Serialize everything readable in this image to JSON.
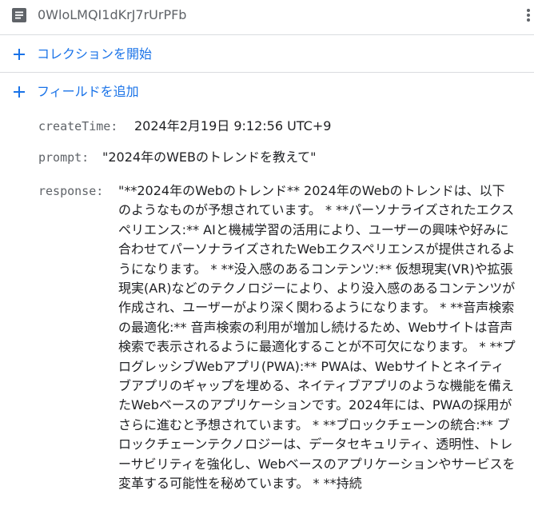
{
  "document": {
    "id": "0WloLMQI1dKrJ7rUrPFb",
    "icon": "document-icon",
    "menu_icon": "more-vert-icon"
  },
  "actions": {
    "start_collection": "コレクションを開始",
    "add_field": "フィールドを追加",
    "icon": "plus-icon",
    "accent_color": "#1a73e8"
  },
  "fields": {
    "createTime": {
      "key": "createTime:",
      "value": "2024年2月19日 9:12:56 UTC+9"
    },
    "prompt": {
      "key": "prompt:",
      "value": "\"2024年のWEBのトレンドを教えて\""
    },
    "response": {
      "key": "response:",
      "value": "\"**2024年のWebのトレンド** 2024年のWebのトレンドは、以下のようなものが予想されています。 * **パーソナライズされたエクスペリエンス:** AIと機械学習の活用により、ユーザーの興味や好みに合わせてパーソナライズされたWebエクスペリエンスが提供されるようになります。 * **没入感のあるコンテンツ:** 仮想現実(VR)や拡張現実(AR)などのテクノロジーにより、より没入感のあるコンテンツが作成され、ユーザーがより深く関わるようになります。 * **音声検索の最適化:** 音声検索の利用が増加し続けるため、Webサイトは音声検索で表示されるように最適化することが不可欠になります。 * **プログレッシブWebアプリ(PWA):** PWAは、Webサイトとネイティブアプリのギャップを埋める、ネイティブアプリのような機能を備えたWebベースのアプリケーションです。2024年には、PWAの採用がさらに進むと予想されています。 * **ブロックチェーンの統合:** ブロックチェーンテクノロジーは、データセキュリティ、透明性、トレーサビリティを強化し、Webベースのアプリケーションやサービスを変革する可能性を秘めています。 * **持続"
    }
  }
}
